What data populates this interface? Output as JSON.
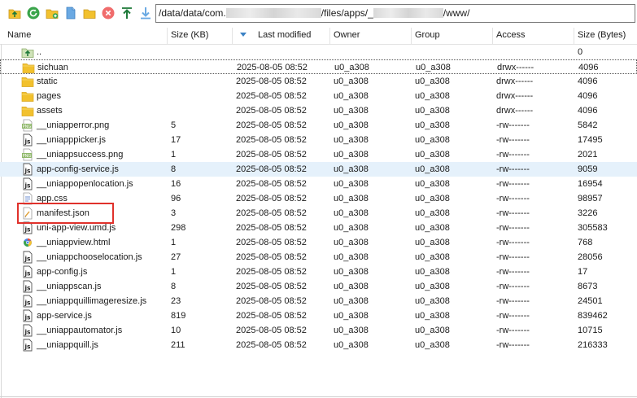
{
  "path": {
    "prefix": "/data/data/com.",
    "middle": "/files/apps/_",
    "suffix": "/www/"
  },
  "columns": {
    "name": "Name",
    "size_kb": "Size (KB)",
    "last_modified": "Last modified",
    "owner": "Owner",
    "group": "Group",
    "access": "Access",
    "size_bytes": "Size (Bytes)"
  },
  "rows": [
    {
      "name": "..",
      "kb": "",
      "mod": "",
      "own": "",
      "grp": "",
      "acc": "",
      "size": "0",
      "icon": "parent-dir-icon"
    },
    {
      "name": "sichuan",
      "kb": "",
      "mod": "2025-08-05 08:52",
      "own": "u0_a308",
      "grp": "u0_a308",
      "acc": "drwx------",
      "size": "4096",
      "icon": "folder-icon"
    },
    {
      "name": "static",
      "kb": "",
      "mod": "2025-08-05 08:52",
      "own": "u0_a308",
      "grp": "u0_a308",
      "acc": "drwx------",
      "size": "4096",
      "icon": "folder-icon"
    },
    {
      "name": "pages",
      "kb": "",
      "mod": "2025-08-05 08:52",
      "own": "u0_a308",
      "grp": "u0_a308",
      "acc": "drwx------",
      "size": "4096",
      "icon": "folder-icon"
    },
    {
      "name": "assets",
      "kb": "",
      "mod": "2025-08-05 08:52",
      "own": "u0_a308",
      "grp": "u0_a308",
      "acc": "drwx------",
      "size": "4096",
      "icon": "folder-icon"
    },
    {
      "name": "__uniapperror.png",
      "kb": "5",
      "mod": "2025-08-05 08:52",
      "own": "u0_a308",
      "grp": "u0_a308",
      "acc": "-rw-------",
      "size": "5842",
      "icon": "png-file-icon"
    },
    {
      "name": "__uniapppicker.js",
      "kb": "17",
      "mod": "2025-08-05 08:52",
      "own": "u0_a308",
      "grp": "u0_a308",
      "acc": "-rw-------",
      "size": "17495",
      "icon": "js-file-icon"
    },
    {
      "name": "__uniappsuccess.png",
      "kb": "1",
      "mod": "2025-08-05 08:52",
      "own": "u0_a308",
      "grp": "u0_a308",
      "acc": "-rw-------",
      "size": "2021",
      "icon": "png-file-icon"
    },
    {
      "name": "app-config-service.js",
      "kb": "8",
      "mod": "2025-08-05 08:52",
      "own": "u0_a308",
      "grp": "u0_a308",
      "acc": "-rw-------",
      "size": "9059",
      "icon": "js-file-icon"
    },
    {
      "name": "__uniappopenlocation.js",
      "kb": "16",
      "mod": "2025-08-05 08:52",
      "own": "u0_a308",
      "grp": "u0_a308",
      "acc": "-rw-------",
      "size": "16954",
      "icon": "js-file-icon"
    },
    {
      "name": "app.css",
      "kb": "96",
      "mod": "2025-08-05 08:52",
      "own": "u0_a308",
      "grp": "u0_a308",
      "acc": "-rw-------",
      "size": "98957",
      "icon": "css-file-icon"
    },
    {
      "name": "manifest.json",
      "kb": "3",
      "mod": "2025-08-05 08:52",
      "own": "u0_a308",
      "grp": "u0_a308",
      "acc": "-rw-------",
      "size": "3226",
      "icon": "json-file-icon"
    },
    {
      "name": "uni-app-view.umd.js",
      "kb": "298",
      "mod": "2025-08-05 08:52",
      "own": "u0_a308",
      "grp": "u0_a308",
      "acc": "-rw-------",
      "size": "305583",
      "icon": "js-file-icon"
    },
    {
      "name": "__uniappview.html",
      "kb": "1",
      "mod": "2025-08-05 08:52",
      "own": "u0_a308",
      "grp": "u0_a308",
      "acc": "-rw-------",
      "size": "768",
      "icon": "html-file-icon"
    },
    {
      "name": "__uniappchooselocation.js",
      "kb": "27",
      "mod": "2025-08-05 08:52",
      "own": "u0_a308",
      "grp": "u0_a308",
      "acc": "-rw-------",
      "size": "28056",
      "icon": "js-file-icon"
    },
    {
      "name": "app-config.js",
      "kb": "1",
      "mod": "2025-08-05 08:52",
      "own": "u0_a308",
      "grp": "u0_a308",
      "acc": "-rw-------",
      "size": "17",
      "icon": "js-file-icon"
    },
    {
      "name": "__uniappscan.js",
      "kb": "8",
      "mod": "2025-08-05 08:52",
      "own": "u0_a308",
      "grp": "u0_a308",
      "acc": "-rw-------",
      "size": "8673",
      "icon": "js-file-icon"
    },
    {
      "name": "__uniappquillimageresize.js",
      "kb": "23",
      "mod": "2025-08-05 08:52",
      "own": "u0_a308",
      "grp": "u0_a308",
      "acc": "-rw-------",
      "size": "24501",
      "icon": "js-file-icon"
    },
    {
      "name": "app-service.js",
      "kb": "819",
      "mod": "2025-08-05 08:52",
      "own": "u0_a308",
      "grp": "u0_a308",
      "acc": "-rw-------",
      "size": "839462",
      "icon": "js-file-icon"
    },
    {
      "name": "__uniappautomator.js",
      "kb": "10",
      "mod": "2025-08-05 08:52",
      "own": "u0_a308",
      "grp": "u0_a308",
      "acc": "-rw-------",
      "size": "10715",
      "icon": "js-file-icon"
    },
    {
      "name": "__uniappquill.js",
      "kb": "211",
      "mod": "2025-08-05 08:52",
      "own": "u0_a308",
      "grp": "u0_a308",
      "acc": "-rw-------",
      "size": "216333",
      "icon": "js-file-icon"
    }
  ],
  "state": {
    "sorted_column": "last_modified",
    "focused_row": "sichuan",
    "hovered_row": "app-config-service.js",
    "highlighted_row": "manifest.json"
  },
  "colors": {
    "folder": "#f2c12e",
    "accent": "#3b82c4",
    "highlight_box": "#e0312b",
    "hover_row": "#e5f1fb"
  }
}
